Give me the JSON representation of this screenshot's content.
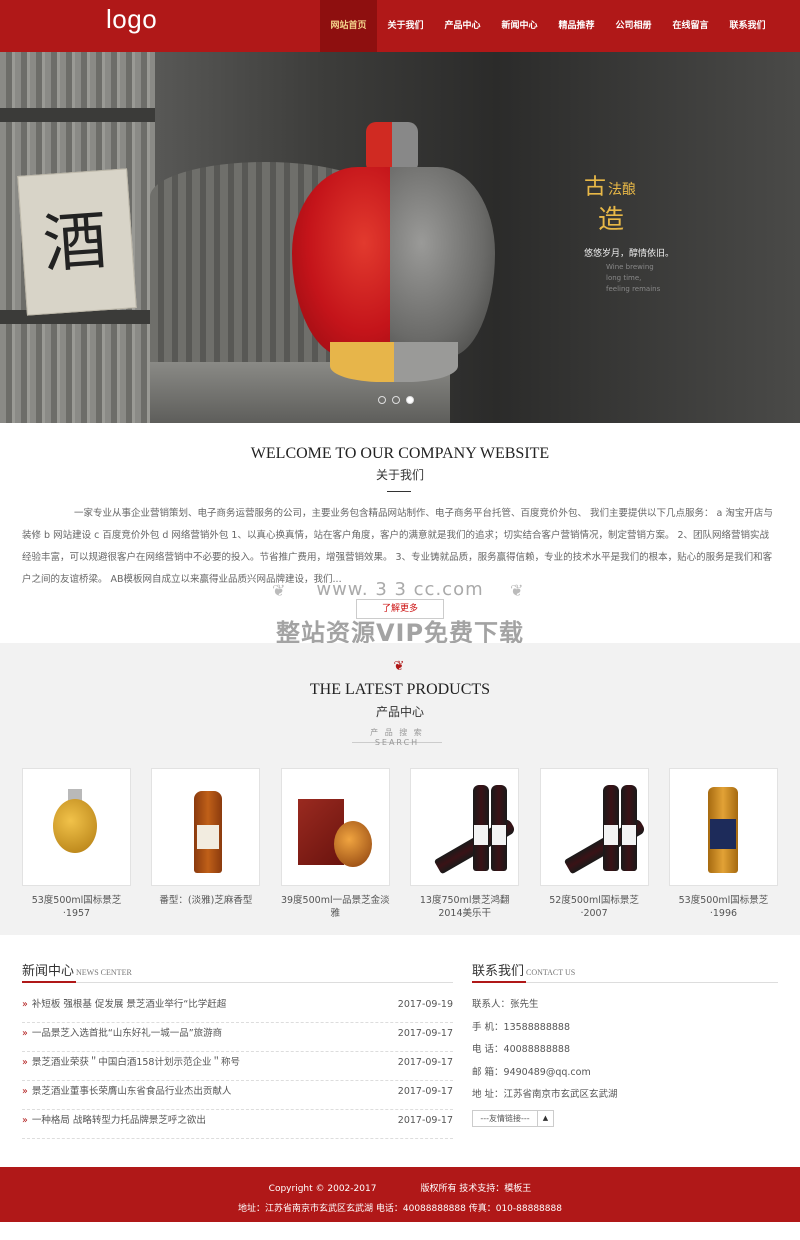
{
  "header": {
    "logo": "logo",
    "nav": [
      "网站首页",
      "关于我们",
      "产品中心",
      "新闻中心",
      "精品推荐",
      "公司相册",
      "在线留言",
      "联系我们"
    ],
    "active_index": 0
  },
  "banner": {
    "sign_char": "酒",
    "line1_big": "古",
    "line1_small": "法酿",
    "line2": "造",
    "subtitle_cn": "悠悠岁月，醇情依旧。",
    "subtitle_en": [
      "Wine brewing",
      "long time,",
      "feeling remains"
    ],
    "slides_total": 3,
    "active_slide": 3
  },
  "about": {
    "title_en": "WELCOME TO OUR COMPANY WEBSITE",
    "title_cn": "关于我们",
    "text": "一家专业从事企业营销策划、电子商务运营服务的公司，主要业务包含精品网站制作、电子商务平台托管、百度竞价外包、 我们主要提供以下几点服务： a 淘宝开店与装修 b 网站建设 c 百度竞价外包 d 网络营销外包 1、以真心换真情，站在客户角度，客户的满意就是我们的追求；切实结合客户营销情况，制定营销方案。 2、团队网络营销实战经验丰富，可以规避很客户在网络营销中不必要的投入。节省推广费用，增强营销效果。 3、专业铸就品质，服务赢得信赖，专业的技术水平是我们的根本，贴心的服务是我们和客户之间的友谊桥梁。 AB模板网自成立以来赢得业品质兴网品牌建设，我们...",
    "watermark_url": "www. 3 3 cc.com",
    "watermark_button": "了解更多",
    "watermark_big": "整站资源VIP免费下载"
  },
  "products": {
    "title_en": "THE LATEST PRODUCTS",
    "title_cn": "产品中心",
    "search_label": "产 品 搜 索 SEARCH",
    "items": [
      {
        "name": "53度500ml国标景芝·1957"
      },
      {
        "name": "番型：(淡雅)芝麻香型"
      },
      {
        "name": "39度500ml一品景芝金淡雅"
      },
      {
        "name": "13度750ml景芝鸿翻2014美乐干"
      },
      {
        "name": "52度500ml国标景芝·2007"
      },
      {
        "name": "53度500ml国标景芝·1996"
      }
    ]
  },
  "news": {
    "title_cn": "新闻中心",
    "title_en": "NEWS CENTER",
    "items": [
      {
        "title": "补短板 强根基 促发展 景芝酒业举行“比学赶超",
        "date": "2017-09-19"
      },
      {
        "title": "一品景芝入选首批“山东好礼一城一品”旅游商",
        "date": "2017-09-17"
      },
      {
        "title": "景芝酒业荣获＂中国白酒158计划示范企业＂称号",
        "date": "2017-09-17"
      },
      {
        "title": "景芝酒业董事长荣膺山东省食品行业杰出贡献人",
        "date": "2017-09-17"
      },
      {
        "title": "一种格局 战略转型力托品牌景芝呼之欲出",
        "date": "2017-09-17"
      }
    ]
  },
  "contact": {
    "title_cn": "联系我们",
    "title_en": "CONTACT US",
    "rows": [
      "联系人：张先生",
      "手 机：13588888888",
      "电 话：40088888888",
      "邮 箱：9490489@qq.com",
      "地 址：江苏省南京市玄武区玄武湖"
    ],
    "friend_label": "---友情链接---",
    "friend_button": "▲"
  },
  "footer": {
    "copyright": "Copyright © 2002-2017",
    "rights": "版权所有 技术支持：模板王",
    "address": "地址：江苏省南京市玄武区玄武湖 电话：40088888888 传真：010-88888888"
  },
  "colors": {
    "brand_red": "#b01818",
    "nav_active_bg": "#8e0f0f",
    "banner_gold": "#e8b847",
    "section_grey": "#f2f2f2"
  }
}
